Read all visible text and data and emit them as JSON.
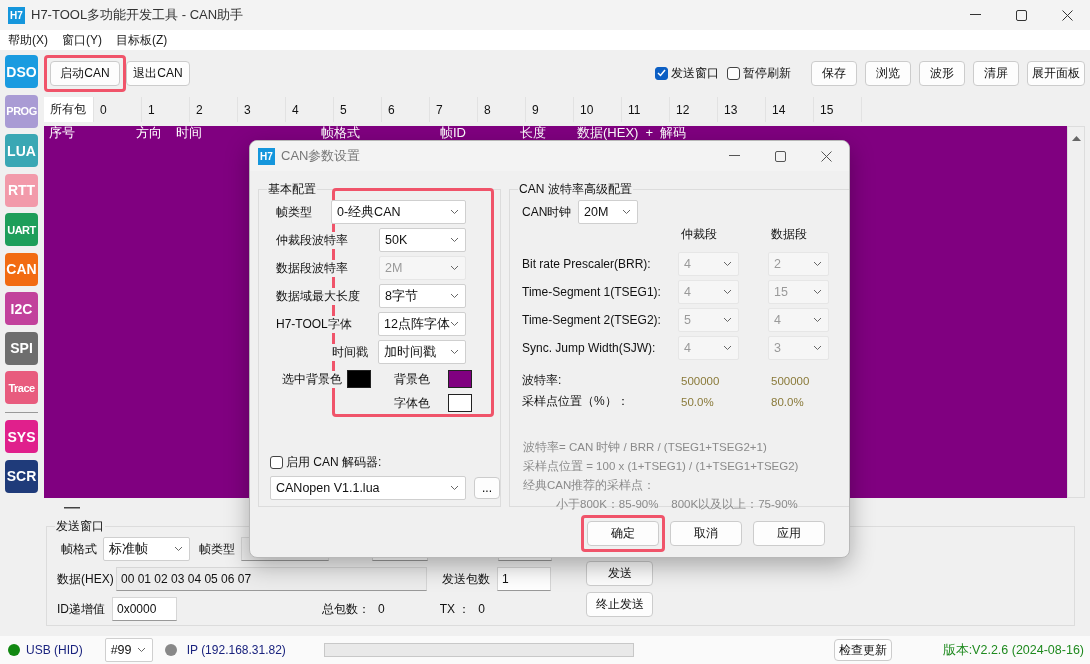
{
  "window": {
    "logo": "H7",
    "title": "H7-TOOL多功能开发工具 - CAN助手"
  },
  "menu": [
    "帮助(X)",
    "窗口(Y)",
    "目标板(Z)"
  ],
  "sidebar": {
    "tools": [
      {
        "label": "DSO",
        "color": "#1a9be0"
      },
      {
        "label": "PROG",
        "color": "#a99bd4"
      },
      {
        "label": "LUA",
        "color": "#3aa7b4"
      },
      {
        "label": "RTT",
        "color": "#f29aaa"
      },
      {
        "label": "UART",
        "color": "#1e9e5a"
      },
      {
        "label": "CAN",
        "color": "#f26b12"
      },
      {
        "label": "I2C",
        "color": "#c2429c"
      },
      {
        "label": "SPI",
        "color": "#6e6e6e"
      },
      {
        "label": "Trace",
        "color": "#e85c7e"
      }
    ],
    "system": [
      {
        "label": "SYS",
        "color": "#e0208c"
      },
      {
        "label": "SCR",
        "color": "#1f3b7a"
      }
    ]
  },
  "toolbar": {
    "buttons": [
      {
        "label": "启动CAN",
        "highlighted": true
      },
      {
        "label": "退出CAN",
        "highlighted": false
      }
    ],
    "checkboxes": [
      {
        "label": "发送窗口",
        "checked": true
      },
      {
        "label": "暂停刷新",
        "checked": false
      }
    ],
    "actions": [
      "保存",
      "浏览",
      "波形",
      "清屏",
      "展开面板"
    ]
  },
  "filter_tabs": [
    {
      "label": "所有包",
      "selected": true
    },
    {
      "label": "0",
      "selected": false
    },
    {
      "label": "1",
      "selected": false
    },
    {
      "label": "2",
      "selected": false
    },
    {
      "label": "3",
      "selected": false
    },
    {
      "label": "4",
      "selected": false
    },
    {
      "label": "5",
      "selected": false
    },
    {
      "label": "6",
      "selected": false
    },
    {
      "label": "7",
      "selected": false
    },
    {
      "label": "8",
      "selected": false
    },
    {
      "label": "9",
      "selected": false
    },
    {
      "label": "10",
      "selected": false
    },
    {
      "label": "11",
      "selected": false
    },
    {
      "label": "12",
      "selected": false
    },
    {
      "label": "13",
      "selected": false
    },
    {
      "label": "14",
      "selected": false
    },
    {
      "label": "15",
      "selected": false
    }
  ],
  "log": {
    "columns": [
      "序号",
      "方向",
      "时间",
      "帧格式",
      "帧ID",
      "长度",
      "数据(HEX)  +  解码"
    ]
  },
  "send_window": {
    "title": "发送窗口",
    "frame_format": {
      "label": "帧格式",
      "value": "标准帧"
    },
    "frame_type": {
      "label": "帧类型"
    },
    "data": {
      "label": "数据(HEX)",
      "value": "00 01 02 03 04 05 06 07"
    },
    "send_count": {
      "label": "发送包数",
      "value": "1"
    },
    "id_increment": {
      "label": "ID递增值",
      "value": "0x0000"
    },
    "total": {
      "label": "总包数：",
      "value": "0"
    },
    "tx": {
      "label": "TX ：",
      "value": "0"
    },
    "buttons": [
      "发送",
      "终止发送"
    ]
  },
  "status_bar": {
    "usb": {
      "label": "USB (HID)",
      "color": "#118811"
    },
    "device": "#99",
    "ip": {
      "label": "IP (192.168.31.82)",
      "color": "#888888"
    },
    "progress": {
      "level": 0
    },
    "update_button": "检查更新",
    "version": "版本:V2.2.6 (2024-08-16)"
  },
  "dialog": {
    "logo": "H7",
    "title": "CAN参数设置",
    "basic": {
      "title": "基本配置",
      "highlighted": true,
      "rows": [
        {
          "label": "帧类型",
          "value": "0-经典CAN",
          "disabled": false
        },
        {
          "label": "仲裁段波特率",
          "value": "50K",
          "disabled": false
        },
        {
          "label": "数据段波特率",
          "value": "2M",
          "disabled": true
        },
        {
          "label": "数据域最大长度",
          "value": "8字节",
          "disabled": false
        },
        {
          "label": "H7-TOOL字体",
          "value": "12点阵字体",
          "disabled": false
        },
        {
          "label": "时间戳",
          "value": "加时间戳",
          "disabled": false
        }
      ],
      "colors": [
        {
          "label": "选中背景色",
          "color": "#000000"
        },
        {
          "label": "背景色",
          "color": "#800080"
        },
        {
          "label": "字体色",
          "color": "#ffffff"
        }
      ],
      "decoder": {
        "label": "启用 CAN 解码器:",
        "checked": false,
        "value": "CANopen V1.1.lua",
        "browse": "..."
      }
    },
    "advanced": {
      "title": "CAN 波特率高级配置",
      "clock": {
        "label": "CAN时钟",
        "value": "20M"
      },
      "headers": [
        "仲裁段",
        "数据段"
      ],
      "rows": [
        {
          "label": "Bit rate  Prescaler(BRR):",
          "arbitration": "4",
          "data": "2",
          "disabled": true
        },
        {
          "label": "Time-Segment 1(TSEG1):",
          "arbitration": "4",
          "data": "15",
          "disabled": true
        },
        {
          "label": "Time-Segment 2(TSEG2):",
          "arbitration": "5",
          "data": "4",
          "disabled": true
        },
        {
          "label": "Sync. Jump Width(SJW):",
          "arbitration": "4",
          "data": "3",
          "disabled": true
        }
      ],
      "results": [
        {
          "label": "波特率:",
          "arbitration": "500000",
          "data": "500000"
        },
        {
          "label": "采样点位置（%）：",
          "arbitration": "50.0%",
          "data": "80.0%"
        }
      ],
      "notes": [
        "波特率= CAN 时钟 / BRR / (TSEG1+TSEG2+1)",
        "采样点位置 = 100 x (1+TSEG1) / (1+TSEG1+TSEG2)",
        "经典CAN推荐的采样点：",
        "小于800K：85-90%    800K以及以上：75-90%"
      ]
    },
    "buttons": [
      {
        "label": "确定",
        "highlighted": true
      },
      {
        "label": "取消",
        "highlighted": false
      },
      {
        "label": "应用",
        "highlighted": false
      }
    ]
  }
}
